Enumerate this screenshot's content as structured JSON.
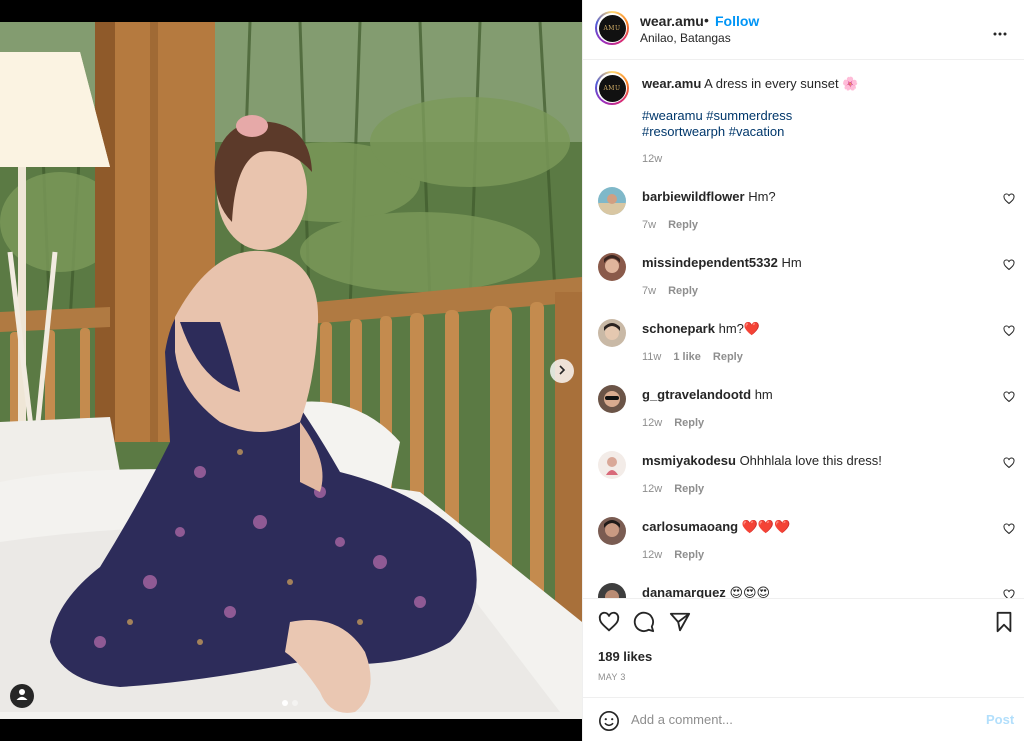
{
  "post": {
    "username": "wear.amu",
    "separator": "•",
    "follow_label": "Follow",
    "location": "Anilao, Batangas",
    "more_icon": "more-horizontal-icon",
    "avatar_text": "AMU"
  },
  "caption": {
    "username": "wear.amu",
    "text": "A dress in every sunset 🌸",
    "tags_line1": "#wearamu #summerdress",
    "tags_line2": "#resortwearph #vacation",
    "time": "12w"
  },
  "comments": [
    {
      "username": "barbiewildflower",
      "text": "Hm?",
      "time": "7w",
      "likes": "",
      "reply": "Reply",
      "avatar_color": "#7fb8c9"
    },
    {
      "username": "missindependent5332",
      "text": "Hm",
      "time": "7w",
      "likes": "",
      "reply": "Reply",
      "avatar_color": "#8a5a4a"
    },
    {
      "username": "schonepark",
      "text": "hm?❤️",
      "time": "11w",
      "likes": "1 like",
      "reply": "Reply",
      "avatar_color": "#c9b9a6"
    },
    {
      "username": "g_gtravelandootd",
      "text": "hm",
      "time": "12w",
      "likes": "",
      "reply": "Reply",
      "avatar_color": "#6b5447"
    },
    {
      "username": "msmiyakodesu",
      "text": "Ohhhlala love this dress!",
      "time": "12w",
      "likes": "",
      "reply": "Reply",
      "avatar_color": "#e6c9c0"
    },
    {
      "username": "carlosumaoang",
      "text": "❤️❤️❤️",
      "time": "12w",
      "likes": "",
      "reply": "Reply",
      "avatar_color": "#7a5c52"
    },
    {
      "username": "danamarquez",
      "text": "😍😍😍",
      "time": "",
      "likes": "",
      "reply": "",
      "avatar_color": "#3e3e3e"
    }
  ],
  "actions": {
    "like_icon": "heart-icon",
    "comment_icon": "comment-icon",
    "share_icon": "share-icon",
    "save_icon": "bookmark-icon",
    "likes": "189 likes",
    "date": "MAY 3"
  },
  "add_comment": {
    "placeholder": "Add a comment...",
    "post_label": "Post",
    "emoji_icon": "emoji-icon"
  },
  "media": {
    "carousel_count": 2,
    "carousel_active": 1,
    "next_icon": "chevron-right-icon",
    "tag_icon": "user-tag-icon"
  },
  "colors": {
    "accent": "#0095f6",
    "hashtag": "#00376b",
    "muted": "#8e8e8e",
    "post_disabled": "#b2dffc"
  }
}
